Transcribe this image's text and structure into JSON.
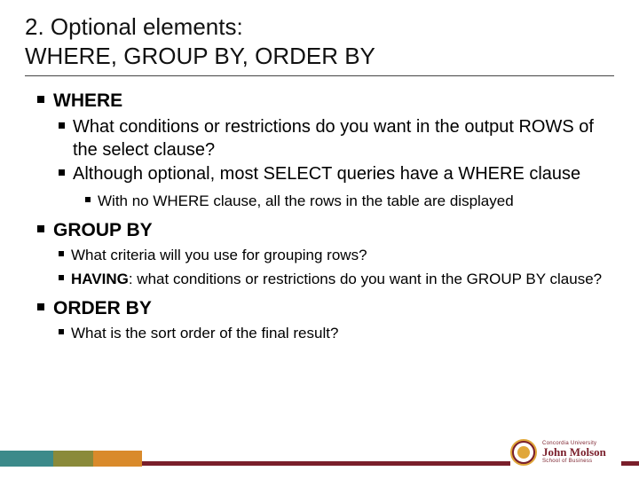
{
  "title": "2. Optional elements:\nWHERE, GROUP BY, ORDER BY",
  "b1": "WHERE",
  "b1_1": "What conditions or restrictions do you want in the output ROWS of the select clause?",
  "b1_2": "Although optional, most SELECT queries have a WHERE clause",
  "b1_2_1": "With no WHERE clause, all the rows in the table are displayed",
  "b2": "GROUP BY",
  "b2_1": "What criteria will you use for grouping rows?",
  "b2_2a": "HAVING",
  "b2_2b": ": what conditions or restrictions do you want in the GROUP BY clause?",
  "b3": "ORDER BY",
  "b3_1": "What is the sort order of the final result?",
  "logo": {
    "uni": "Concordia University",
    "name": "John Molson",
    "school": "School of Business"
  }
}
